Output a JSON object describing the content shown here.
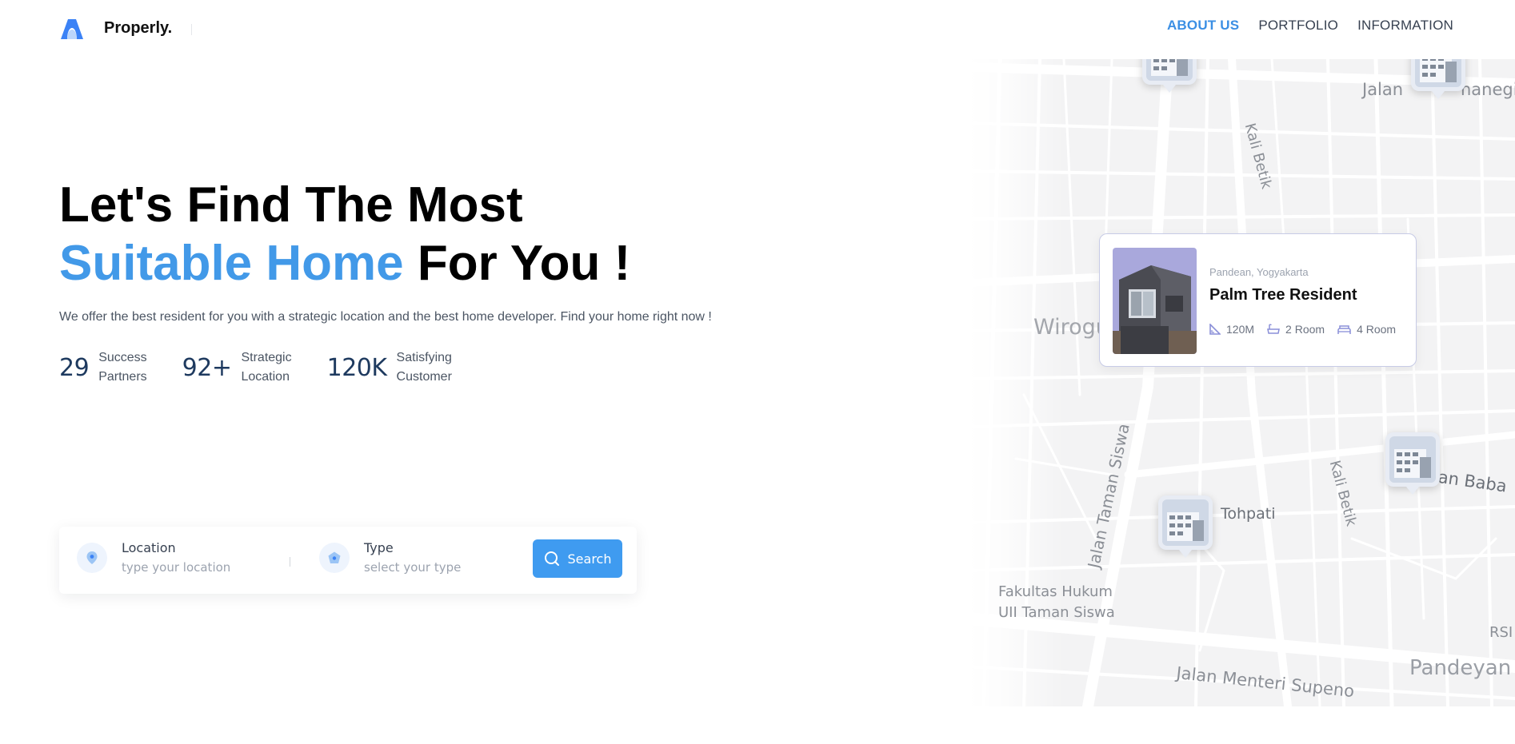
{
  "nav": {
    "brand": "Properly.",
    "links": [
      {
        "label": "ABOUT US",
        "active": true
      },
      {
        "label": "PORTFOLIO",
        "active": false
      },
      {
        "label": "INFORMATION",
        "active": false
      }
    ]
  },
  "hero": {
    "title_line1": "Let's Find The Most",
    "title_accent": "Suitable Home",
    "title_rest": " For You !",
    "description": "We offer the best resident for you with a strategic location and the best home developer. Find your home right now !"
  },
  "stats": [
    {
      "number": "29",
      "label_line1": "Success",
      "label_line2": "Partners"
    },
    {
      "number": "92+",
      "label_line1": "Strategic",
      "label_line2": "Location"
    },
    {
      "number": "120K",
      "label_line1": "Satisfying",
      "label_line2": "Customer"
    }
  ],
  "search": {
    "location_label": "Location",
    "location_placeholder": "type your location",
    "type_label": "Type",
    "type_placeholder": "select your type",
    "button_label": "Search"
  },
  "map": {
    "labels": {
      "jalan_top": "Jalan",
      "jalan_top_right": "hanegi",
      "kali_betik_1": "Kali Betik",
      "kali_betik_2": "Kali Betik",
      "wirogu": "Wirogu",
      "taman_siswa": "Jalan Taman Siswa",
      "tohpati": "Tohpati",
      "babaran": "lan Baba",
      "fakultas_1": "Fakultas Hukum",
      "fakultas_2": "UII Taman Siswa",
      "rsi": "RSI",
      "pandeyan": "Pandeyan",
      "menteri": "Jalan Menteri Supeno"
    }
  },
  "property": {
    "location": "Pandean, Yogyakarta",
    "name": "Palm Tree Resident",
    "area": "120M",
    "rooms": "2 Room",
    "bedrooms": "4 Room"
  },
  "colors": {
    "accent": "#4299e8",
    "button": "#3f9bf0",
    "stat_number": "#1e3a5f"
  }
}
